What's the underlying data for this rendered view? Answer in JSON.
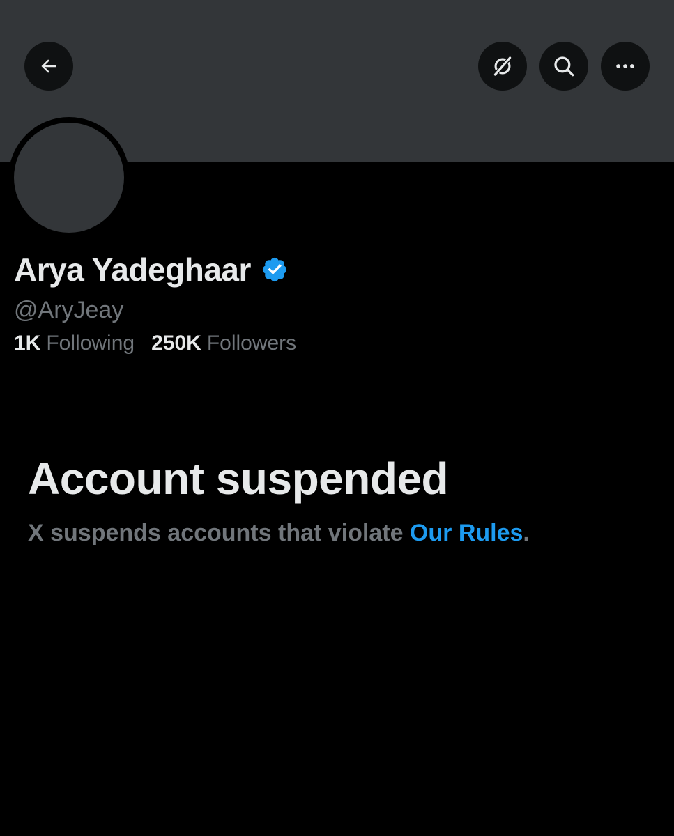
{
  "header": {
    "back_icon": "arrow-left-icon",
    "grok_icon": "grok-icon",
    "search_icon": "search-icon",
    "more_icon": "more-horizontal-icon"
  },
  "profile": {
    "display_name": "Arya Yadeghaar",
    "handle": "@AryJeay",
    "verified_icon": "verified-badge-icon",
    "following_count": "1K",
    "following_label": "Following",
    "followers_count": "250K",
    "followers_label": "Followers"
  },
  "suspension": {
    "title": "Account suspended",
    "description": "X suspends accounts that violate ",
    "rules_link": "Our Rules",
    "period": "."
  },
  "colors": {
    "background": "#000000",
    "banner": "#333639",
    "text_primary": "#e7e9ea",
    "text_secondary": "#71767b",
    "link": "#1d9bf0",
    "verified": "#1d9bf0"
  }
}
